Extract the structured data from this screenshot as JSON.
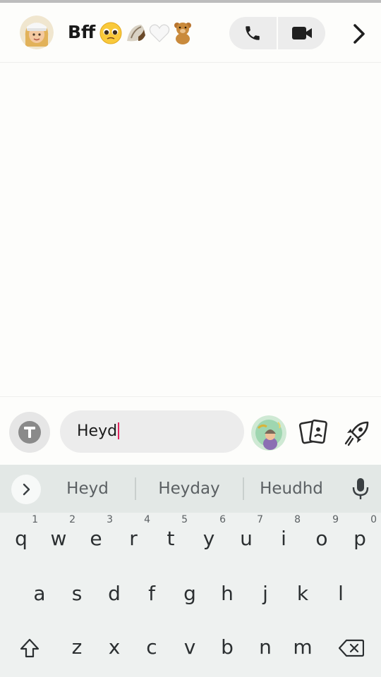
{
  "header": {
    "chat_name": "Bff",
    "emoji_icons": [
      "pleading-face-icon",
      "shell-icon",
      "white-heart-icon",
      "teddy-bear-icon"
    ],
    "call_icon": "phone-icon",
    "video_icon": "video-camera-icon",
    "next_icon": "chevron-right-icon"
  },
  "composer": {
    "text_value": "Heyd"
  },
  "keyboard": {
    "suggestions": [
      "Heyd",
      "Heyday",
      "Heudhd"
    ],
    "row1": [
      {
        "letter": "q",
        "digit": "1"
      },
      {
        "letter": "w",
        "digit": "2"
      },
      {
        "letter": "e",
        "digit": "3"
      },
      {
        "letter": "r",
        "digit": "4"
      },
      {
        "letter": "t",
        "digit": "5"
      },
      {
        "letter": "y",
        "digit": "6"
      },
      {
        "letter": "u",
        "digit": "7"
      },
      {
        "letter": "i",
        "digit": "8"
      },
      {
        "letter": "o",
        "digit": "9"
      },
      {
        "letter": "p",
        "digit": "0"
      }
    ],
    "row2": [
      "a",
      "s",
      "d",
      "f",
      "g",
      "h",
      "j",
      "k",
      "l"
    ],
    "row3": [
      "z",
      "x",
      "c",
      "v",
      "b",
      "n",
      "m"
    ]
  },
  "colors": {
    "background": "#fdfdfb",
    "keyboard_bg": "#eef1f0",
    "suggest_bg": "#e3e8e6",
    "caret": "#e0245e"
  }
}
